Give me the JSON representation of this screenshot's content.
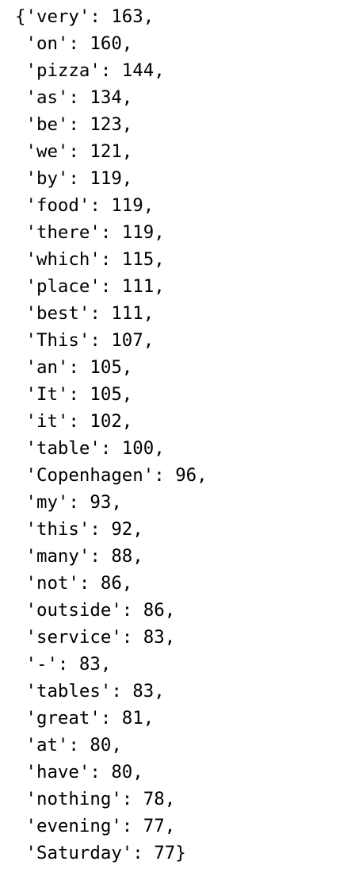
{
  "output": {
    "lines": [
      "{'very': 163,",
      " 'on': 160,",
      " 'pizza': 144,",
      " 'as': 134,",
      " 'be': 123,",
      " 'we': 121,",
      " 'by': 119,",
      " 'food': 119,",
      " 'there': 119,",
      " 'which': 115,",
      " 'place': 111,",
      " 'best': 111,",
      " 'This': 107,",
      " 'an': 105,",
      " 'It': 105,",
      " 'it': 102,",
      " 'table': 100,",
      " 'Copenhagen': 96,",
      " 'my': 93,",
      " 'this': 92,",
      " 'many': 88,",
      " 'not': 86,",
      " 'outside': 86,",
      " 'service': 83,",
      " '-': 83,",
      " 'tables': 83,",
      " 'great': 81,",
      " 'at': 80,",
      " 'have': 80,",
      " 'nothing': 78,",
      " 'evening': 77,",
      " 'Saturday': 77}"
    ]
  }
}
